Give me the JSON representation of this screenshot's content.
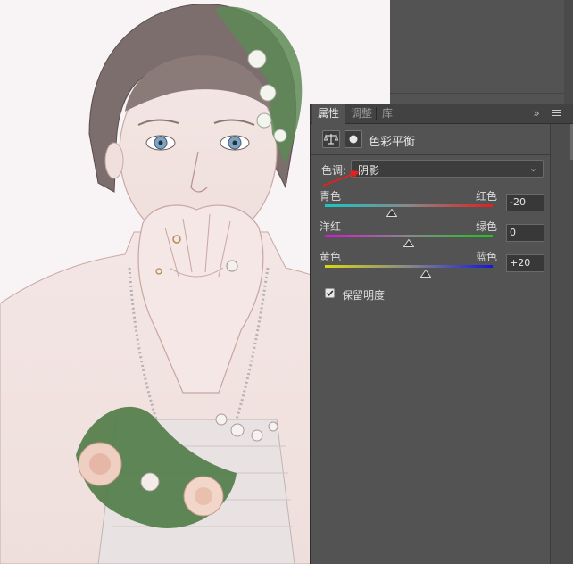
{
  "tabs": [
    {
      "label": "属性",
      "active": true
    },
    {
      "label": "调整",
      "active": false
    },
    {
      "label": "库",
      "active": false
    }
  ],
  "panel": {
    "collapse_icon": "double-chevron-right-icon",
    "menu_icon": "panel-menu-icon",
    "title": "色彩平衡",
    "title_icons": [
      "balance-scale-icon",
      "layer-mask-icon"
    ]
  },
  "tone": {
    "label": "色调:",
    "value": "阴影"
  },
  "sliders": [
    {
      "left": "青色",
      "right": "红色",
      "value": "-20",
      "amount": -20,
      "left_color": "#16c8c8",
      "right_color": "#e02020"
    },
    {
      "left": "洋红",
      "right": "绿色",
      "value": "0",
      "amount": 0,
      "left_color": "#d616d6",
      "right_color": "#18c818"
    },
    {
      "left": "黄色",
      "right": "蓝色",
      "value": "+20",
      "amount": 20,
      "left_color": "#d8d814",
      "right_color": "#1818d8"
    }
  ],
  "preserve_luminosity": {
    "label": "保留明度",
    "checked": true
  },
  "colors": {
    "panel_bg": "#535353",
    "tab_bg": "#424242",
    "annotation_arrow": "#e02222"
  }
}
